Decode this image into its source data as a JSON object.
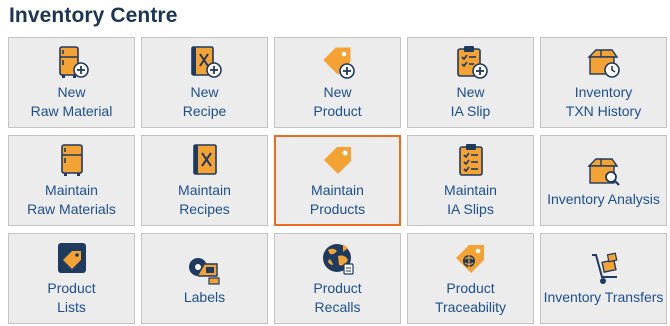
{
  "page": {
    "title": "Inventory Centre"
  },
  "colors": {
    "accent": "#f4a233",
    "navy": "#1f3a5f",
    "link": "#1d4f8f",
    "selected_border": "#ef6c1e"
  },
  "tiles": [
    {
      "line1": "New",
      "line2": "Raw Material",
      "icon": "fridge-plus-icon"
    },
    {
      "line1": "New",
      "line2": "Recipe",
      "icon": "recipe-book-plus-icon"
    },
    {
      "line1": "New",
      "line2": "Product",
      "icon": "price-tag-plus-icon"
    },
    {
      "line1": "New",
      "line2": "IA Slip",
      "icon": "clipboard-plus-icon"
    },
    {
      "line1": "Inventory",
      "line2": "TXN History",
      "icon": "box-clock-icon"
    },
    {
      "line1": "Maintain",
      "line2": "Raw Materials",
      "icon": "fridge-icon"
    },
    {
      "line1": "Maintain",
      "line2": "Recipes",
      "icon": "recipe-book-icon"
    },
    {
      "line1": "Maintain",
      "line2": "Products",
      "icon": "price-tag-icon",
      "selected": true
    },
    {
      "line1": "Maintain",
      "line2": "IA Slips",
      "icon": "clipboard-checklist-icon"
    },
    {
      "line1": "Inventory Analysis",
      "line2": "",
      "icon": "box-search-icon"
    },
    {
      "line1": "Product",
      "line2": "Lists",
      "icon": "tag-card-icon"
    },
    {
      "line1": "Labels",
      "line2": "",
      "icon": "label-roll-icon"
    },
    {
      "line1": "Product",
      "line2": "Recalls",
      "icon": "recall-globe-icon"
    },
    {
      "line1": "Product",
      "line2": "Traceability",
      "icon": "traceability-tag-icon"
    },
    {
      "line1": "Inventory Transfers",
      "line2": "",
      "icon": "hand-truck-icon"
    }
  ]
}
